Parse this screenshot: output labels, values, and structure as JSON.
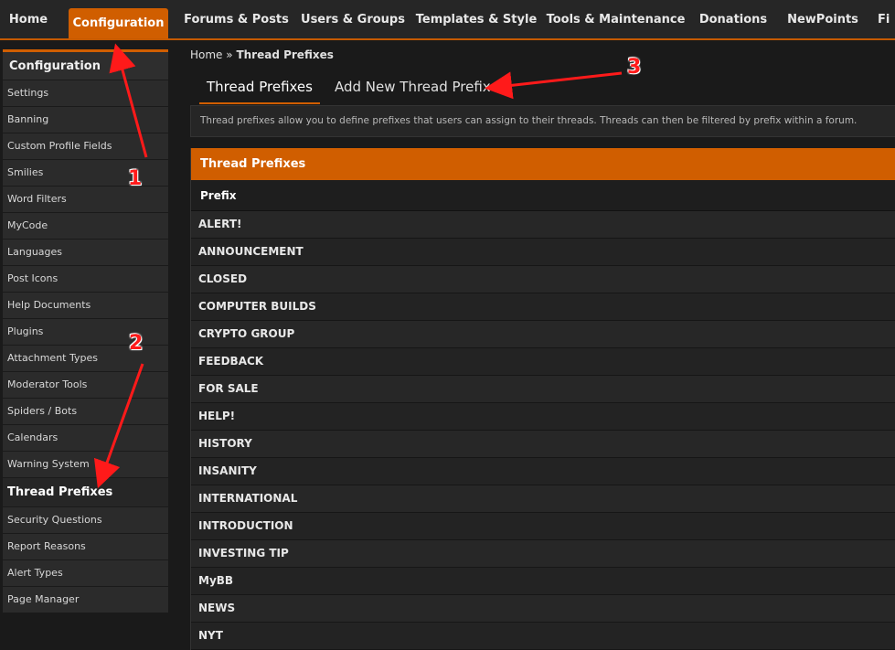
{
  "topnav": {
    "tabs": [
      {
        "label": "Home"
      },
      {
        "label": "Configuration"
      },
      {
        "label": "Forums & Posts"
      },
      {
        "label": "Users & Groups"
      },
      {
        "label": "Templates & Style"
      },
      {
        "label": "Tools & Maintenance"
      },
      {
        "label": "Donations"
      },
      {
        "label": "NewPoints"
      },
      {
        "label": "Fi"
      }
    ],
    "active": "Configuration"
  },
  "sidebar": {
    "title": "Configuration",
    "items": [
      {
        "label": "Settings"
      },
      {
        "label": "Banning"
      },
      {
        "label": "Custom Profile Fields"
      },
      {
        "label": "Smilies"
      },
      {
        "label": "Word Filters"
      },
      {
        "label": "MyCode"
      },
      {
        "label": "Languages"
      },
      {
        "label": "Post Icons"
      },
      {
        "label": "Help Documents"
      },
      {
        "label": "Plugins"
      },
      {
        "label": "Attachment Types"
      },
      {
        "label": "Moderator Tools"
      },
      {
        "label": "Spiders / Bots"
      },
      {
        "label": "Calendars"
      },
      {
        "label": "Warning System"
      },
      {
        "label": "Thread Prefixes"
      },
      {
        "label": "Security Questions"
      },
      {
        "label": "Report Reasons"
      },
      {
        "label": "Alert Types"
      },
      {
        "label": "Page Manager"
      }
    ],
    "active": "Thread Prefixes"
  },
  "breadcrumb": {
    "home": "Home",
    "separator": "»",
    "current": "Thread Prefixes"
  },
  "subtabs": {
    "active_label": "Thread Prefixes",
    "add_label": "Add New Thread Prefix"
  },
  "description": "Thread prefixes allow you to define prefixes that users can assign to their threads. Threads can then be filtered by prefix within a forum.",
  "table": {
    "title": "Thread Prefixes",
    "column_header": "Prefix",
    "rows": [
      "ALERT!",
      "ANNOUNCEMENT",
      "CLOSED",
      "COMPUTER BUILDS",
      "CRYPTO GROUP",
      "FEEDBACK",
      "FOR SALE",
      "HELP!",
      "HISTORY",
      "INSANITY",
      "INTERNATIONAL",
      "INTRODUCTION",
      "INVESTING TIP",
      "MyBB",
      "NEWS",
      "NYT"
    ]
  },
  "annotations": {
    "color": "#ff1a1a",
    "numbers": [
      "1",
      "2",
      "3"
    ]
  },
  "colors": {
    "accent": "#d05e00"
  }
}
